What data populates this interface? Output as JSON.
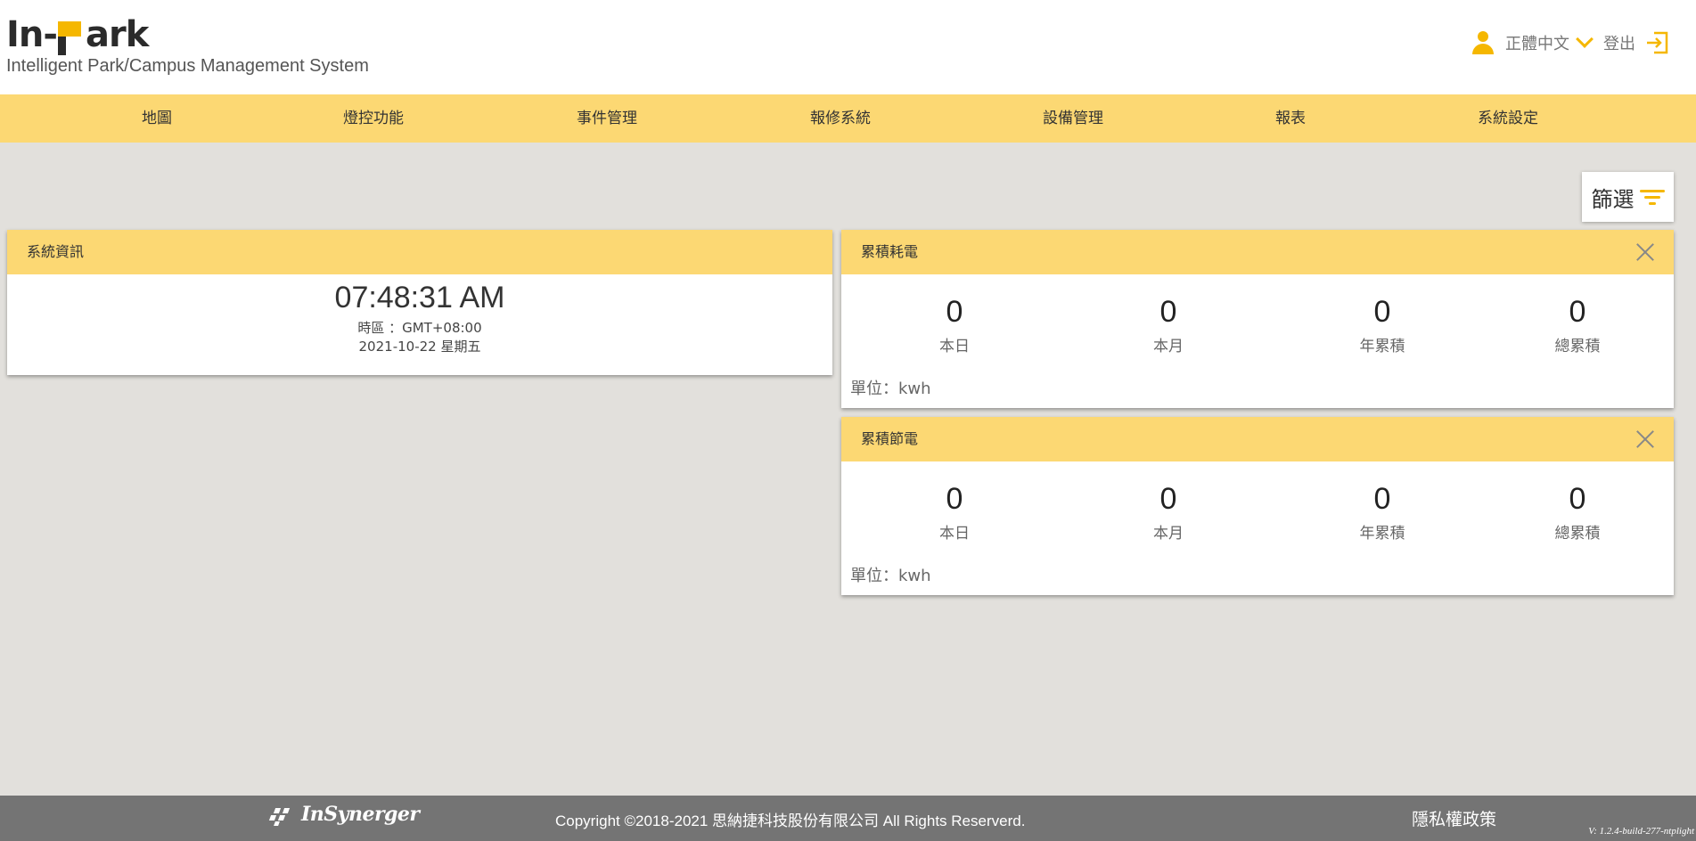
{
  "header": {
    "logo_text_left": "In-",
    "logo_text_right": "ark",
    "logo_subtitle": "Intelligent Park/Campus Management System",
    "language": "正體中文",
    "logout": "登出"
  },
  "nav": {
    "items": [
      {
        "label": "地圖"
      },
      {
        "label": "燈控功能"
      },
      {
        "label": "事件管理"
      },
      {
        "label": "報修系統"
      },
      {
        "label": "設備管理"
      },
      {
        "label": "報表"
      },
      {
        "label": "系統設定"
      }
    ]
  },
  "filter": {
    "label": "篩選"
  },
  "system_info": {
    "title": "系統資訊",
    "time": "07:48:31 AM",
    "timezone": "時區 ：GMT+08:00",
    "date": "2021-10-22 星期五"
  },
  "power_consumption": {
    "title": "累積耗電",
    "stats": [
      {
        "value": "0",
        "label": "本日"
      },
      {
        "value": "0",
        "label": "本月"
      },
      {
        "value": "0",
        "label": "年累積"
      },
      {
        "value": "0",
        "label": "總累積"
      }
    ],
    "unit": "單位：kwh"
  },
  "power_saving": {
    "title": "累積節電",
    "stats": [
      {
        "value": "0",
        "label": "本日"
      },
      {
        "value": "0",
        "label": "本月"
      },
      {
        "value": "0",
        "label": "年累積"
      },
      {
        "value": "0",
        "label": "總累積"
      }
    ],
    "unit": "單位：kwh"
  },
  "footer": {
    "brand": "InSynerger",
    "copyright": "Copyright ©2018-2021 思納捷科技股份有限公司 All Rights Reserverd.",
    "privacy": "隱私權政策",
    "version": "V: 1.2.4-build-277-ntplight"
  },
  "colors": {
    "accent": "#f5b700",
    "nav_bg": "#fcd873",
    "page_bg": "#e2e0dc",
    "footer_bg": "#747474"
  }
}
